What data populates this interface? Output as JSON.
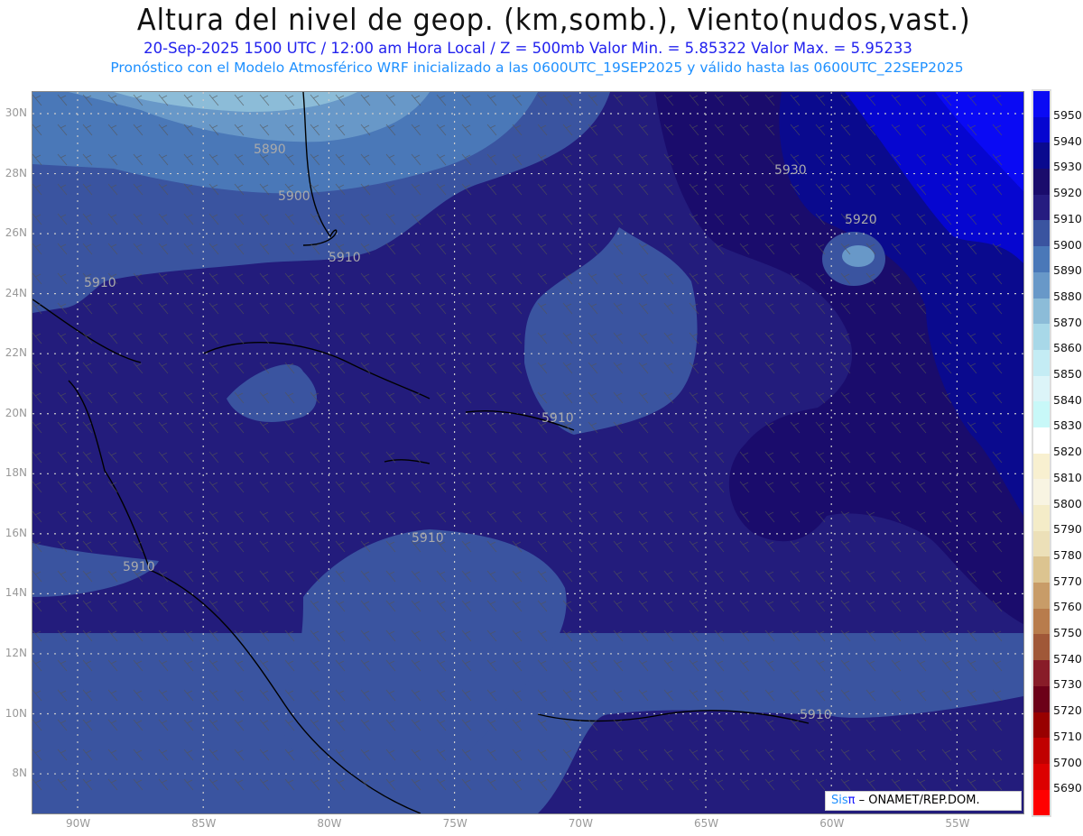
{
  "title": "Altura del nivel de geop. (km,somb.), Viento(nudos,vast.)",
  "subtitle_1": "20-Sep-2025  1500 UTC / 12:00 am Hora Local / Z = 500mb    Valor Min. = 5.85322  Valor Max. = 5.95233",
  "subtitle_2": "Pronóstico con el Modelo Atmosférico WRF inicializado a las 0600UTC_19SEP2025 y válido hasta las  0600UTC_22SEP2025",
  "lat_ticks": [
    "30N",
    "28N",
    "26N",
    "24N",
    "22N",
    "20N",
    "18N",
    "16N",
    "14N",
    "12N",
    "10N",
    "8N"
  ],
  "lon_ticks": [
    "90W",
    "85W",
    "80W",
    "75W",
    "70W",
    "65W",
    "60W",
    "55W"
  ],
  "contour_labels": [
    "5890",
    "5900",
    "5910",
    "5910",
    "5910",
    "5910",
    "5910",
    "5910",
    "5920",
    "5930"
  ],
  "colorbar": {
    "labels": [
      "5950",
      "5940",
      "5930",
      "5920",
      "5910",
      "5900",
      "5890",
      "5880",
      "5870",
      "5860",
      "5850",
      "5840",
      "5830",
      "5820",
      "5810",
      "5800",
      "5790",
      "5780",
      "5770",
      "5760",
      "5750",
      "5740",
      "5730",
      "5720",
      "5710",
      "5700",
      "5690"
    ],
    "colors": [
      "#0a0af4",
      "#0606d0",
      "#0a0a8e",
      "#1a0c6c",
      "#261c80",
      "#3a54a0",
      "#4a78b8",
      "#6898c8",
      "#8cbcd8",
      "#a8d8e8",
      "#c4ecf4",
      "#dcf4f8",
      "#c8f8f8",
      "#ffffff",
      "#f8f0d0",
      "#f8f4e2",
      "#f4ecc8",
      "#ece0b8",
      "#dcc490",
      "#c89c68",
      "#b87c4c",
      "#a05838",
      "#881c28",
      "#6c0018",
      "#980000",
      "#c00000",
      "#dc0000",
      "#ff0000"
    ]
  },
  "credit": {
    "logo_text": "Sis",
    "logo_pi": "π",
    "text": "– ONAMET/REP.DOM."
  }
}
